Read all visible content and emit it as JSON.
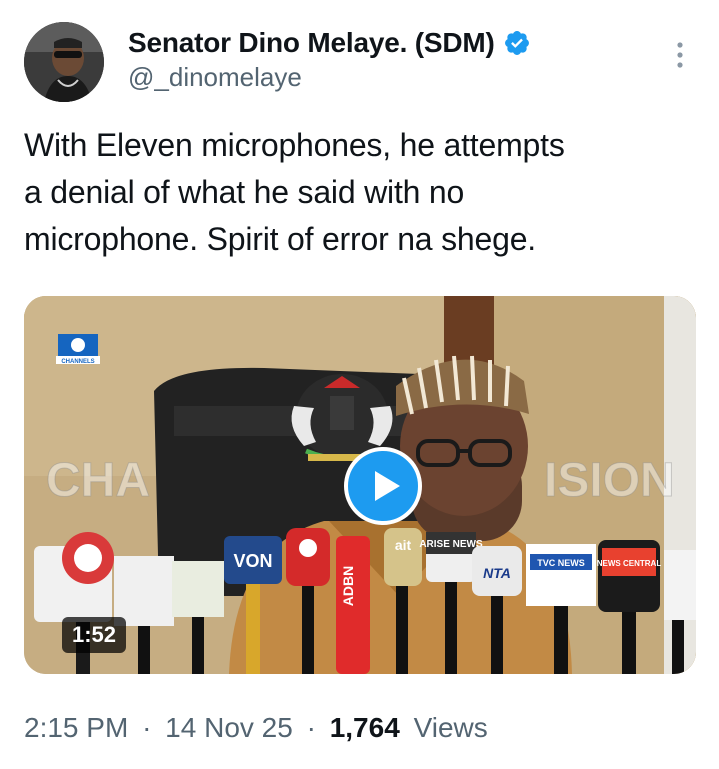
{
  "author": {
    "display_name": "Senator Dino Melaye. (SDM)",
    "handle": "@_dinomelaye",
    "verified": true
  },
  "tweet": {
    "line1": "With Eleven microphones, he attempts",
    "line2": "a denial of what he said with no",
    "line3": "microphone. Spirit of error na shege."
  },
  "media": {
    "type": "video",
    "duration": "1:52",
    "watermark_channel": "CHANNELS",
    "watermark_left": "CHA",
    "watermark_right": "ISION",
    "mic_labels": {
      "von": "VON",
      "arise": "ARISE NEWS",
      "tvc": "TVC NEWS",
      "news_central": "NEWS CENTRAL",
      "nta": "NTA",
      "ait": "ait"
    }
  },
  "meta": {
    "time": "2:15 PM",
    "separator": "·",
    "date": "14 Nov 25",
    "views_count": "1,764",
    "views_label": "Views"
  },
  "colors": {
    "accent": "#1d9bf0",
    "text_primary": "#0f1419",
    "text_secondary": "#536471"
  },
  "icons": {
    "verified": "verified-badge-icon",
    "more": "more-vertical-icon",
    "play": "play-icon"
  }
}
